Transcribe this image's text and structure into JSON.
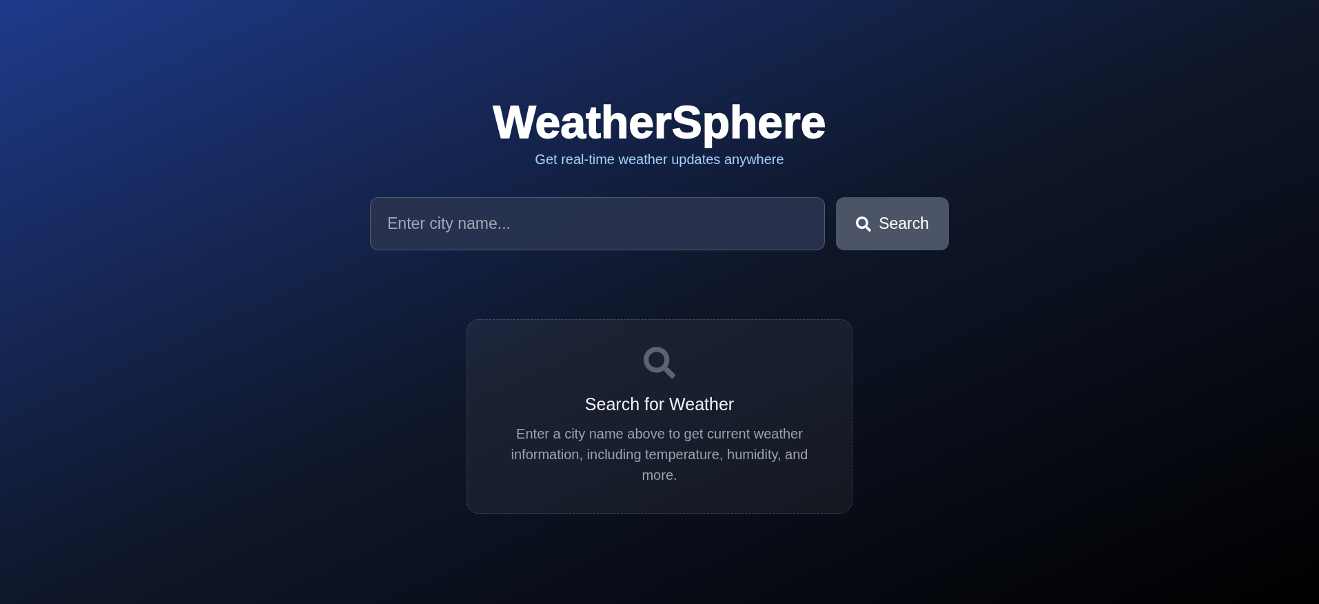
{
  "header": {
    "title": "WeatherSphere",
    "subtitle": "Get real-time weather updates anywhere"
  },
  "search": {
    "placeholder": "Enter city name...",
    "button": "Search"
  },
  "empty_state": {
    "title": "Search for Weather",
    "message": "Enter a city name above to get current weather information, including temperature, humidity, and more."
  }
}
